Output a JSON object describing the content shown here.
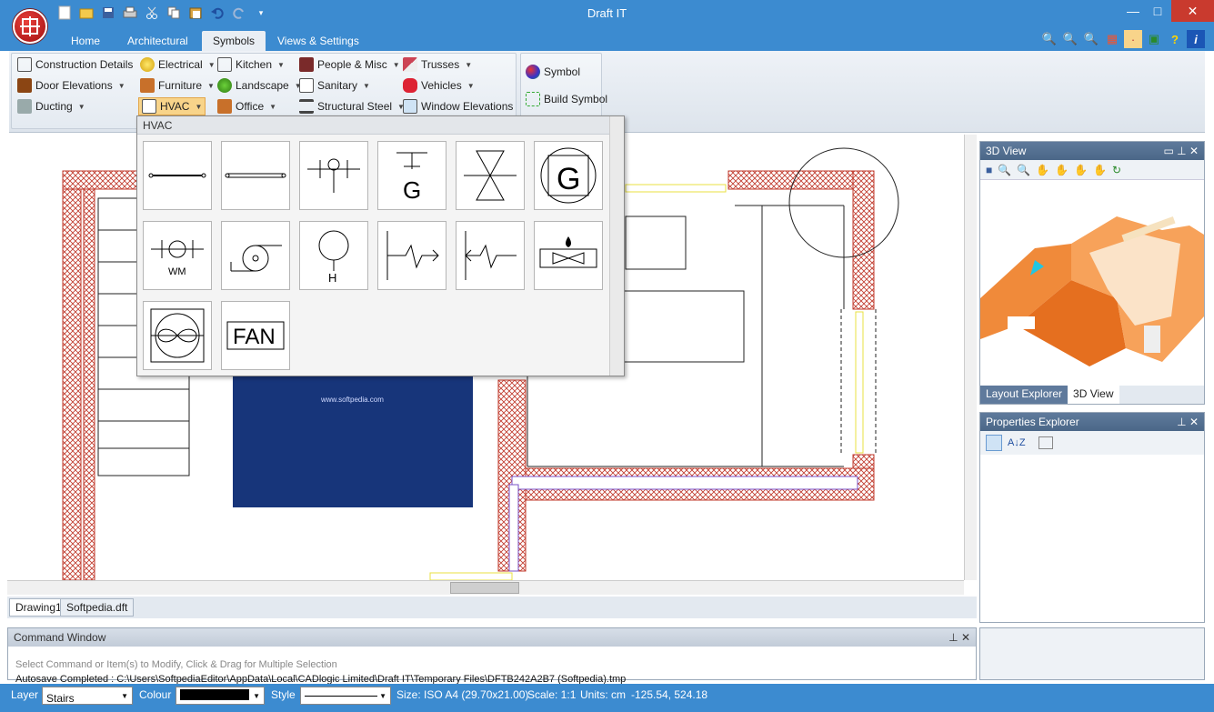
{
  "app": {
    "title": "Draft IT"
  },
  "tabs": [
    {
      "label": "Home"
    },
    {
      "label": "Architectural"
    },
    {
      "label": "Symbols"
    },
    {
      "label": "Views & Settings"
    }
  ],
  "ribbon": {
    "items": [
      {
        "label": "Construction Details"
      },
      {
        "label": "Electrical"
      },
      {
        "label": "Kitchen"
      },
      {
        "label": "People & Misc"
      },
      {
        "label": "Trusses"
      },
      {
        "label": "Door Elevations"
      },
      {
        "label": "Furniture"
      },
      {
        "label": "Landscape"
      },
      {
        "label": "Sanitary"
      },
      {
        "label": "Vehicles"
      },
      {
        "label": "Ducting"
      },
      {
        "label": "HVAC"
      },
      {
        "label": "Office"
      },
      {
        "label": "Structural Steel"
      },
      {
        "label": "Window Elevations"
      }
    ],
    "symbol_label": "Symbol",
    "build_symbol_label": "Build Symbol"
  },
  "hvac_popup": {
    "title": "HVAC",
    "cells": [
      {
        "icon": "duct-line-icon"
      },
      {
        "icon": "double-duct-icon"
      },
      {
        "icon": "valve-circle-icon"
      },
      {
        "icon": "gas-g-icon"
      },
      {
        "icon": "butterfly-valve-icon"
      },
      {
        "icon": "gas-meter-icon",
        "text": "G"
      },
      {
        "icon": "washing-machine-icon",
        "text": "WM"
      },
      {
        "icon": "pump-icon"
      },
      {
        "icon": "heater-circle-icon",
        "text": "H"
      },
      {
        "icon": "flow-right-icon"
      },
      {
        "icon": "flow-left-icon"
      },
      {
        "icon": "burner-fan-icon"
      },
      {
        "icon": "round-fan-icon"
      },
      {
        "icon": "fan-text-icon",
        "text": "FAN"
      }
    ]
  },
  "canvas": {
    "watermark": "www.softpedia.com"
  },
  "doc_tabs": [
    {
      "label": "Drawing1"
    },
    {
      "label": "Softpedia.dft"
    }
  ],
  "command_window": {
    "title": "Command Window",
    "prompt": "Select Command or Item(s) to Modify, Click & Drag for Multiple Selection",
    "log": "Autosave Completed : C:\\Users\\SoftpediaEditor\\AppData\\Local\\CADlogic Limited\\Draft IT\\Temporary Files\\DFTB242A2B7 (Softpedia).tmp"
  },
  "panels": {
    "view3d_title": "3D View",
    "layout_explorer_tab": "Layout Explorer",
    "view3d_tab": "3D View",
    "properties_title": "Properties Explorer"
  },
  "status": {
    "layer_label": "Layer",
    "layer_value": "Stairs",
    "colour_label": "Colour",
    "style_label": "Style",
    "size": "Size: ISO A4 (29.70x21.00)",
    "scale": "Scale: 1:1",
    "units": "Units: cm",
    "coords": "-125.54, 524.18"
  },
  "colors": {
    "titlebar": "#3c8bd0",
    "wall_hatch": "#c0392b",
    "accent": "#e3a64a"
  }
}
